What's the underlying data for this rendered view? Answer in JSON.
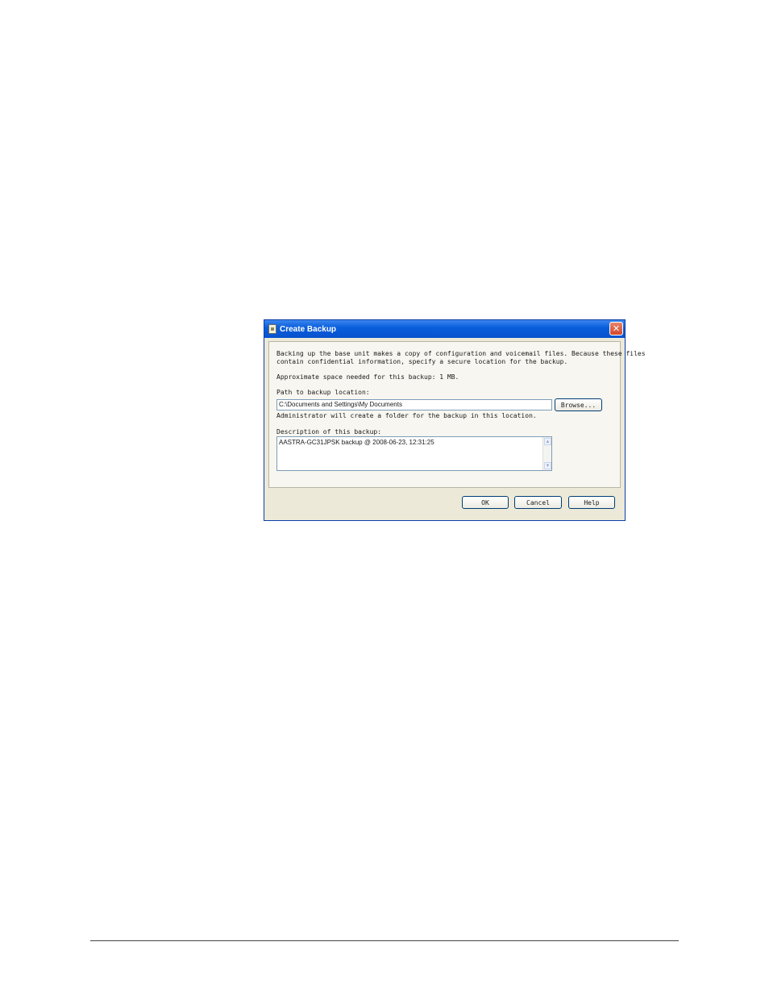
{
  "dialog": {
    "title": "Create Backup",
    "intro_line1": "Backing up the base unit makes a copy of configuration and voicemail files. Because these files",
    "intro_line2": "contain confidential information, specify a secure location for the backup.",
    "space_text": "Approximate space needed for this backup: 1 MB.",
    "path_label": "Path to backup location:",
    "path_value": "C:\\Documents and Settings\\My Documents",
    "browse_label": "Browse...",
    "path_hint": "Administrator will create a folder for the backup in this location.",
    "description_label": "Description of this backup:",
    "description_value": "AASTRA-GC31JPSK backup @ 2008-06-23, 12:31:25",
    "ok_label": "OK",
    "cancel_label": "Cancel",
    "help_label": "Help"
  },
  "icons": {
    "app": "backup-document-icon",
    "close": "close-icon"
  },
  "colors": {
    "titlebar": "#0a5fdc",
    "close_button": "#d2472a",
    "dialog_bg": "#ece9d8"
  }
}
